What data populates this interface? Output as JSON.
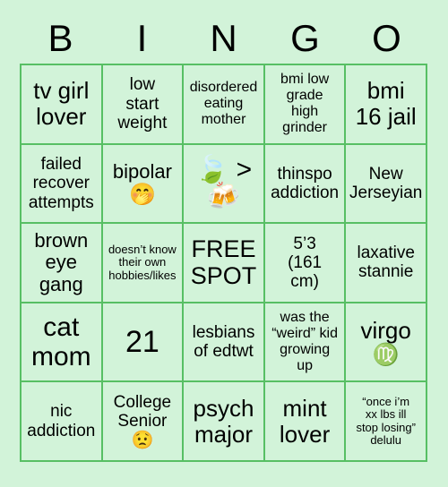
{
  "card": {
    "title_letters": [
      "B",
      "I",
      "N",
      "G",
      "O"
    ],
    "colors": {
      "page_background": "#d2f3d9",
      "cell_background": "#d2f3d9",
      "grid_border": "#57bf64",
      "text": "#000000"
    },
    "columns": 5,
    "rows": 5,
    "cells": [
      {
        "text": "tv girl\nlover",
        "emoji": "",
        "size": "fs-xl"
      },
      {
        "text": "low\nstart\nweight",
        "emoji": "",
        "size": "fs-md"
      },
      {
        "text": "disordered\neating\nmother",
        "emoji": "",
        "size": "fs-sm"
      },
      {
        "text": "bmi low\ngrade\nhigh\ngrinder",
        "emoji": "",
        "size": "fs-sm"
      },
      {
        "text": "bmi\n16 jail",
        "emoji": "",
        "size": "fs-xl"
      },
      {
        "text": "failed\nrecover\nattempts",
        "emoji": "",
        "size": "fs-md"
      },
      {
        "text": "bipolar",
        "emoji": "🤭",
        "size": "fs-lg",
        "emoji_size": "em-md"
      },
      {
        "text": "",
        "emoji": "🍃 >\n🍻",
        "size": "fs-md",
        "emoji_size": "em-lg"
      },
      {
        "text": "thinspo\naddiction",
        "emoji": "",
        "size": "fs-md"
      },
      {
        "text": "New\nJerseyian",
        "emoji": "",
        "size": "fs-md"
      },
      {
        "text": "brown\neye\ngang",
        "emoji": "",
        "size": "fs-lg"
      },
      {
        "text": "doesn’t know\ntheir own\nhobbies/likes",
        "emoji": "",
        "size": "fs-xs"
      },
      {
        "text": "FREE\nSPOT",
        "emoji": "",
        "size": "free"
      },
      {
        "text": "5’3\n(161\ncm)",
        "emoji": "",
        "size": "fs-md"
      },
      {
        "text": "laxative\nstannie",
        "emoji": "",
        "size": "fs-md"
      },
      {
        "text": "cat\nmom",
        "emoji": "",
        "size": "fs-xxl"
      },
      {
        "text": "21",
        "emoji": "",
        "size": "num-21"
      },
      {
        "text": "lesbians\nof edtwt",
        "emoji": "",
        "size": "fs-md"
      },
      {
        "text": "was the\n“weird” kid\ngrowing\nup",
        "emoji": "",
        "size": "fs-sm"
      },
      {
        "text": "virgo",
        "emoji": "♍",
        "size": "fs-xl",
        "emoji_size": "em-md"
      },
      {
        "text": "nic\naddiction",
        "emoji": "",
        "size": "fs-md"
      },
      {
        "text": "College\nSenior",
        "emoji": "😟",
        "size": "fs-md",
        "emoji_size": "em-sm"
      },
      {
        "text": "psych\nmajor",
        "emoji": "",
        "size": "fs-xl"
      },
      {
        "text": "mint\nlover",
        "emoji": "",
        "size": "fs-xl"
      },
      {
        "text": "“once i’m\nxx lbs ill\nstop losing”\ndelulu",
        "emoji": "",
        "size": "fs-xs"
      }
    ]
  }
}
